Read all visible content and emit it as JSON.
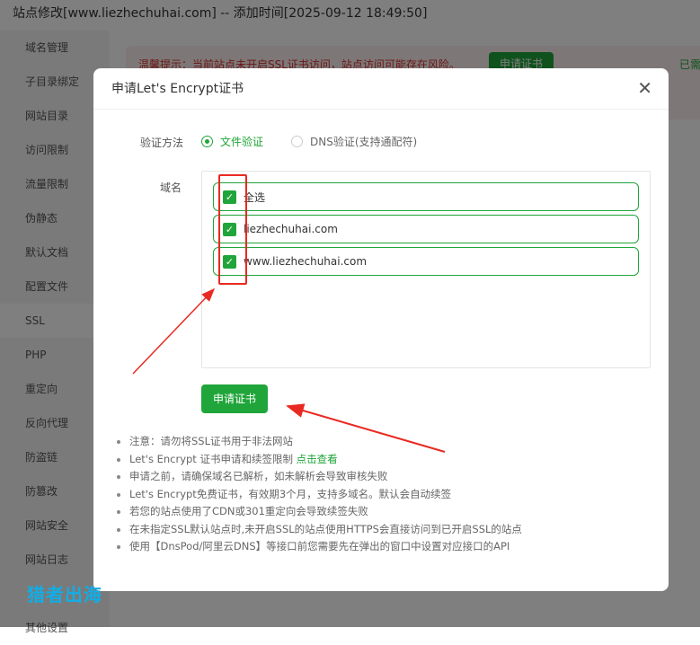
{
  "title": "站点修改[www.liezhechuhai.com] -- 添加时间[2025-09-12 18:49:50]",
  "sidebar": {
    "items": [
      "域名管理",
      "子目录绑定",
      "网站目录",
      "访问限制",
      "流量限制",
      "伪静态",
      "默认文档",
      "配置文件",
      "SSL",
      "PHP",
      "重定向",
      "反向代理",
      "防盗链",
      "防篡改",
      "网站安全",
      "网站日志",
      "其他设置"
    ],
    "active": "SSL"
  },
  "warning": {
    "text": "温馨提示：当前站点未开启SSL证书访问，站点访问可能存在风险。",
    "button": "申请证书",
    "right": "已需"
  },
  "modal": {
    "title": "申请Let's Encrypt证书",
    "close_icon": "close-icon",
    "verify_label": "验证方法",
    "methods": [
      {
        "label": "文件验证",
        "selected": true
      },
      {
        "label": "DNS验证(支持通配符)",
        "selected": false
      }
    ],
    "domain_label": "域名",
    "domains": [
      {
        "label": "全选",
        "checked": true
      },
      {
        "label": "liezhechuhai.com",
        "checked": true
      },
      {
        "label": "www.liezhechuhai.com",
        "checked": true
      }
    ],
    "apply_button": "申请证书",
    "notes": {
      "warn": "注意：请勿将SSL证书用于非法网站",
      "limit": "Let's Encrypt 证书申请和续签限制 ",
      "limit_link": "点击查看",
      "items": [
        "申请之前，请确保域名已解析，如未解析会导致审核失败",
        "Let's Encrypt免费证书，有效期3个月，支持多域名。默认会自动续签",
        "若您的站点使用了CDN或301重定向会导致续签失败",
        "在未指定SSL默认站点时,未开启SSL的站点使用HTTPS会直接访问到已开启SSL的站点",
        "使用【DnsPod/阿里云DNS】等接口前您需要先在弹出的窗口中设置对应接口的API"
      ]
    }
  },
  "watermark": "猎者出海",
  "colors": {
    "accent": "#20a53a",
    "danger": "#e40b0b",
    "annotation": "#e92a22"
  }
}
